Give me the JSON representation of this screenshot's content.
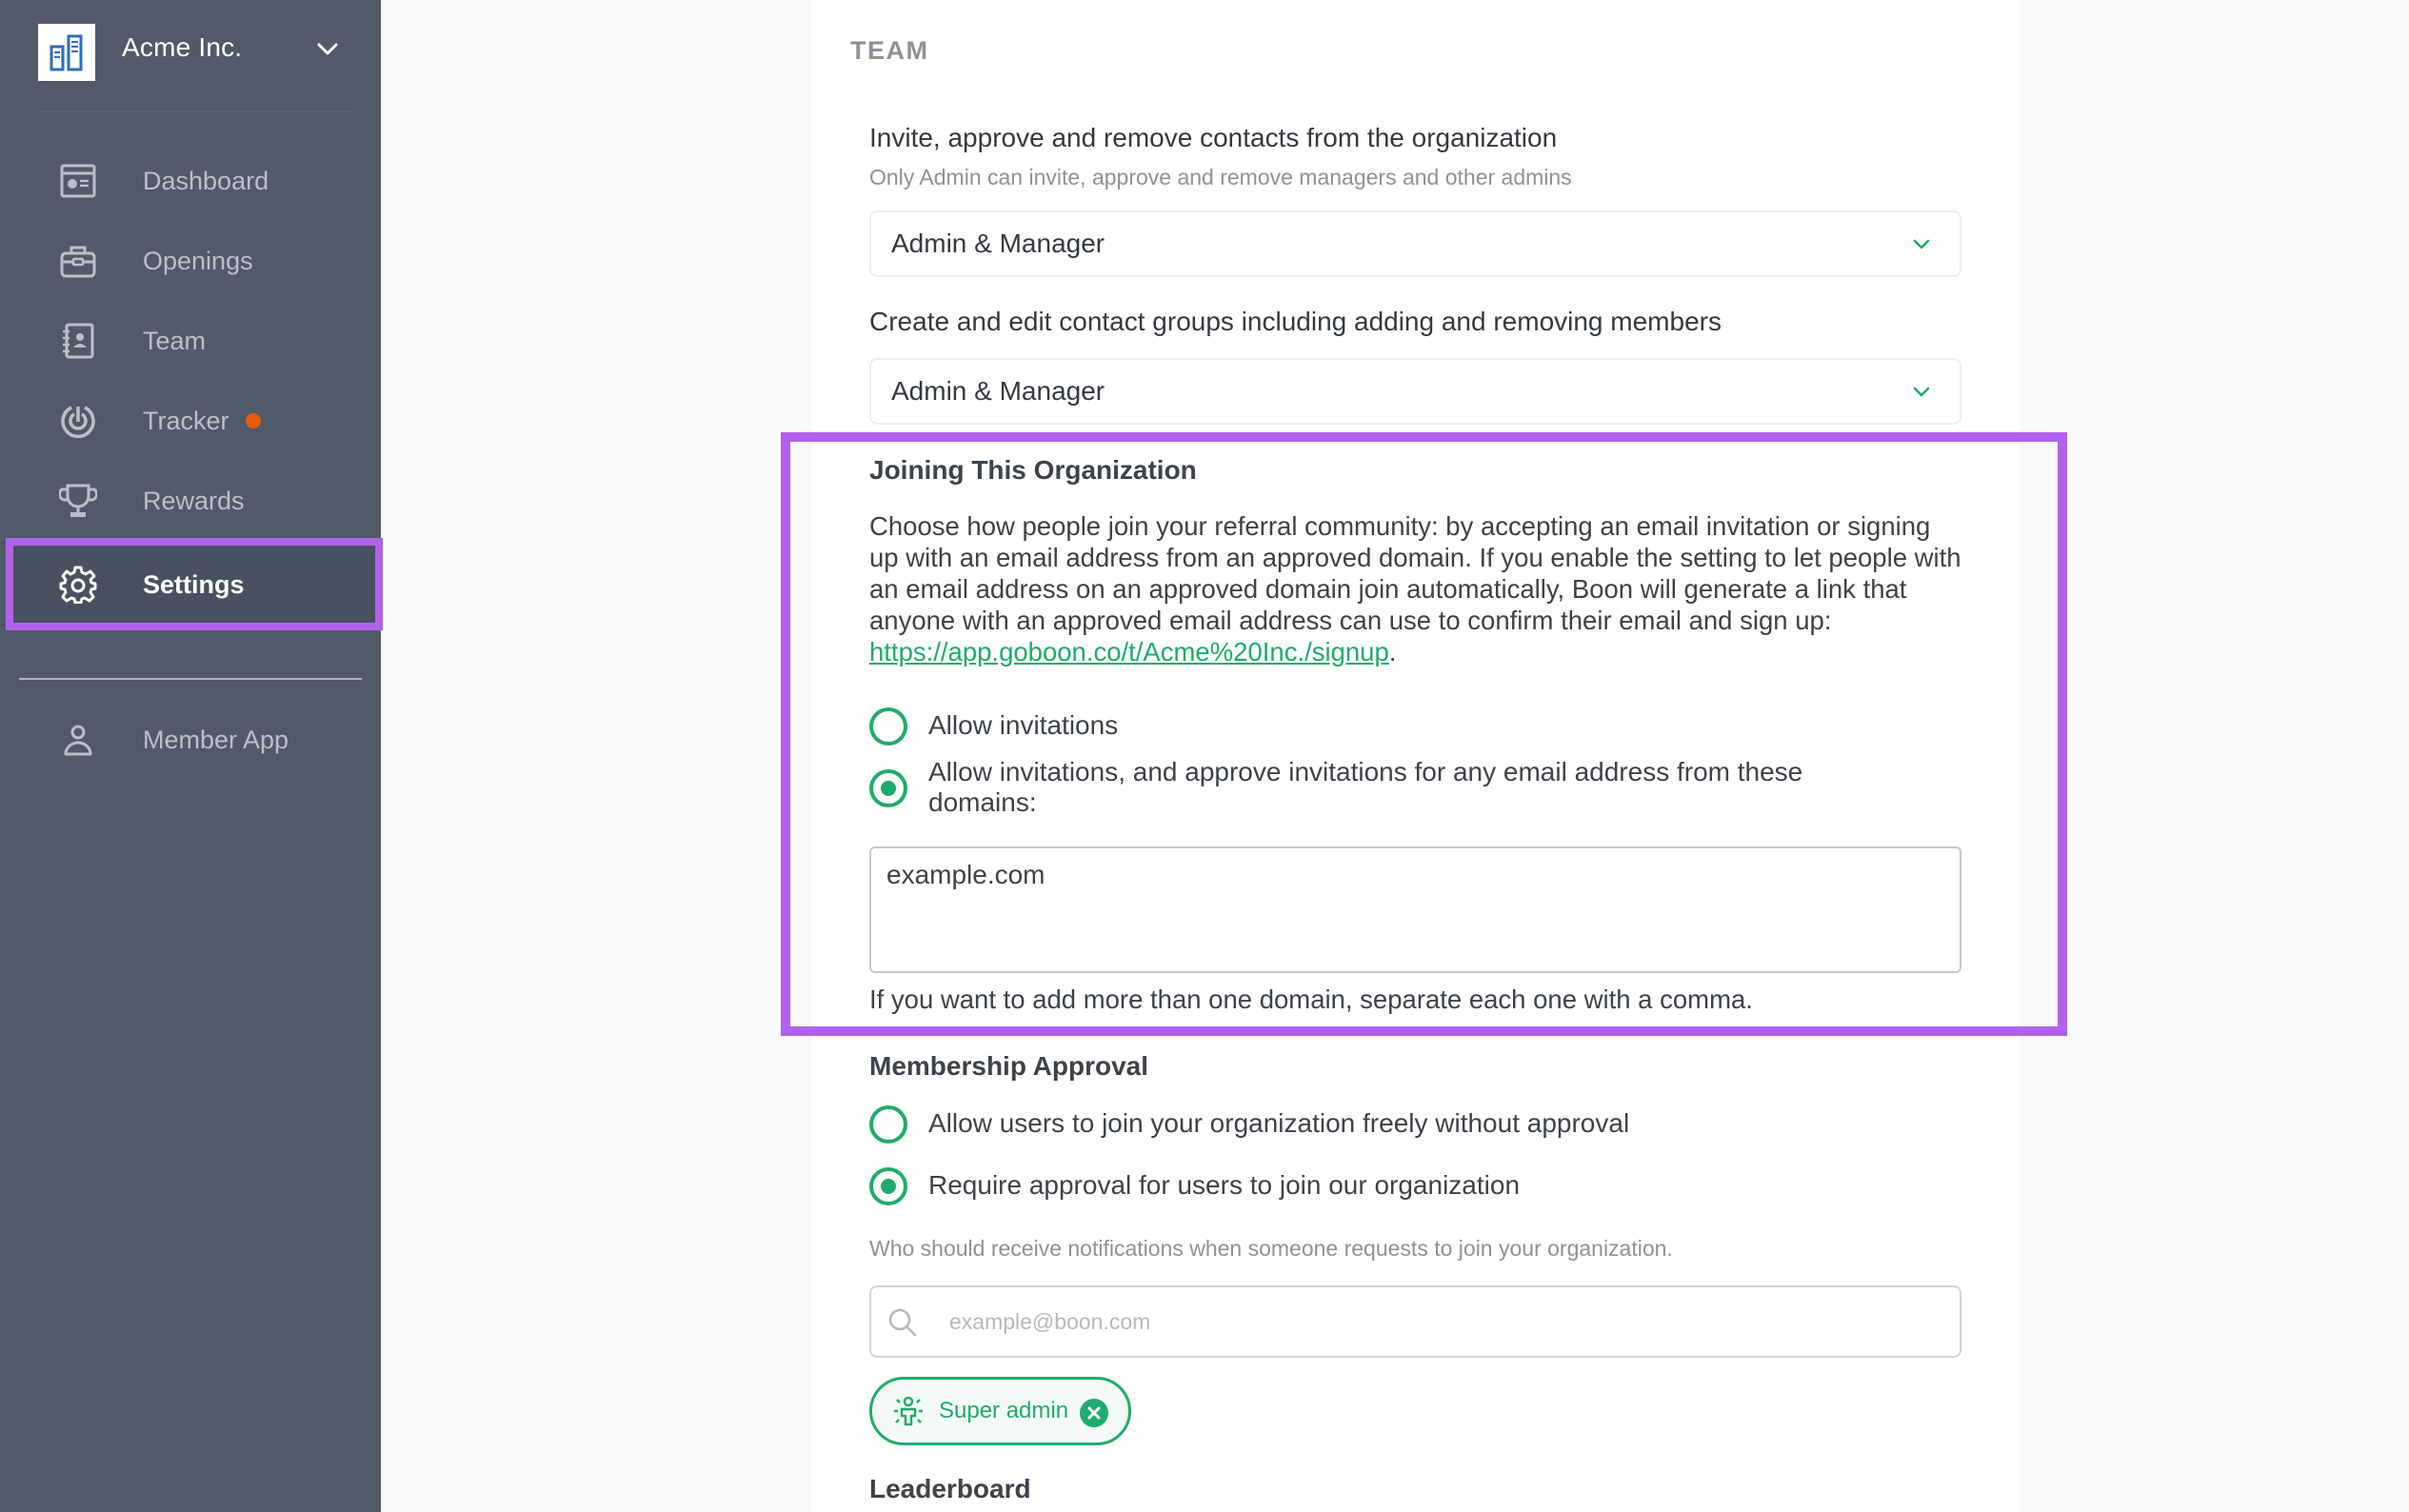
{
  "sidebar": {
    "org_name": "Acme Inc.",
    "items": [
      {
        "label": "Dashboard",
        "icon": "dashboard-icon"
      },
      {
        "label": "Openings",
        "icon": "briefcase-icon"
      },
      {
        "label": "Team",
        "icon": "contacts-book-icon"
      },
      {
        "label": "Tracker",
        "icon": "radar-icon",
        "badge": "notification-dot"
      },
      {
        "label": "Rewards",
        "icon": "trophy-icon"
      },
      {
        "label": "Settings",
        "icon": "gear-icon",
        "active": true
      }
    ],
    "secondary_items": [
      {
        "label": "Member App",
        "icon": "user-icon"
      }
    ]
  },
  "main": {
    "section_title": "TEAM",
    "invite_permission": {
      "label": "Invite, approve and remove contacts from the organization",
      "help": "Only Admin can invite, approve and remove managers and other admins",
      "selected": "Admin & Manager"
    },
    "groups_permission": {
      "label": "Create and edit contact groups including adding and removing members",
      "selected": "Admin & Manager"
    },
    "joining": {
      "heading": "Joining This Organization",
      "description": "Choose how people join your referral community: by accepting an email invitation or signing up with an email address from an approved domain. If you enable the setting to let people with an email address on an approved domain join automatically, Boon will generate a link that anyone with an approved email address can use to confirm their email and sign up: ",
      "signup_link": "https://app.goboon.co/t/Acme%20Inc./signup",
      "description_end": ".",
      "options": [
        {
          "label": "Allow invitations",
          "checked": false
        },
        {
          "label": "Allow invitations, and approve invitations for any email address from these domains:",
          "checked": true
        }
      ],
      "domains_value": "example.com",
      "domains_help": "If you want to add more than one domain, separate each one with a comma."
    },
    "membership": {
      "heading": "Membership Approval",
      "options": [
        {
          "label": "Allow users to join your organization freely without approval",
          "checked": false
        },
        {
          "label": "Require approval for users to join our organization",
          "checked": true
        }
      ],
      "notify_help": "Who should receive notifications when someone requests to join your organization.",
      "search_placeholder": "example@boon.com",
      "chips": [
        {
          "label": "Super admin",
          "icon": "super-admin-icon"
        }
      ]
    },
    "leaderboard_heading": "Leaderboard"
  },
  "colors": {
    "sidebar_bg": "#505a69",
    "accent_green": "#1fac6b",
    "highlight_purple": "#b061ec",
    "tracker_dot": "#ea5a0c"
  }
}
